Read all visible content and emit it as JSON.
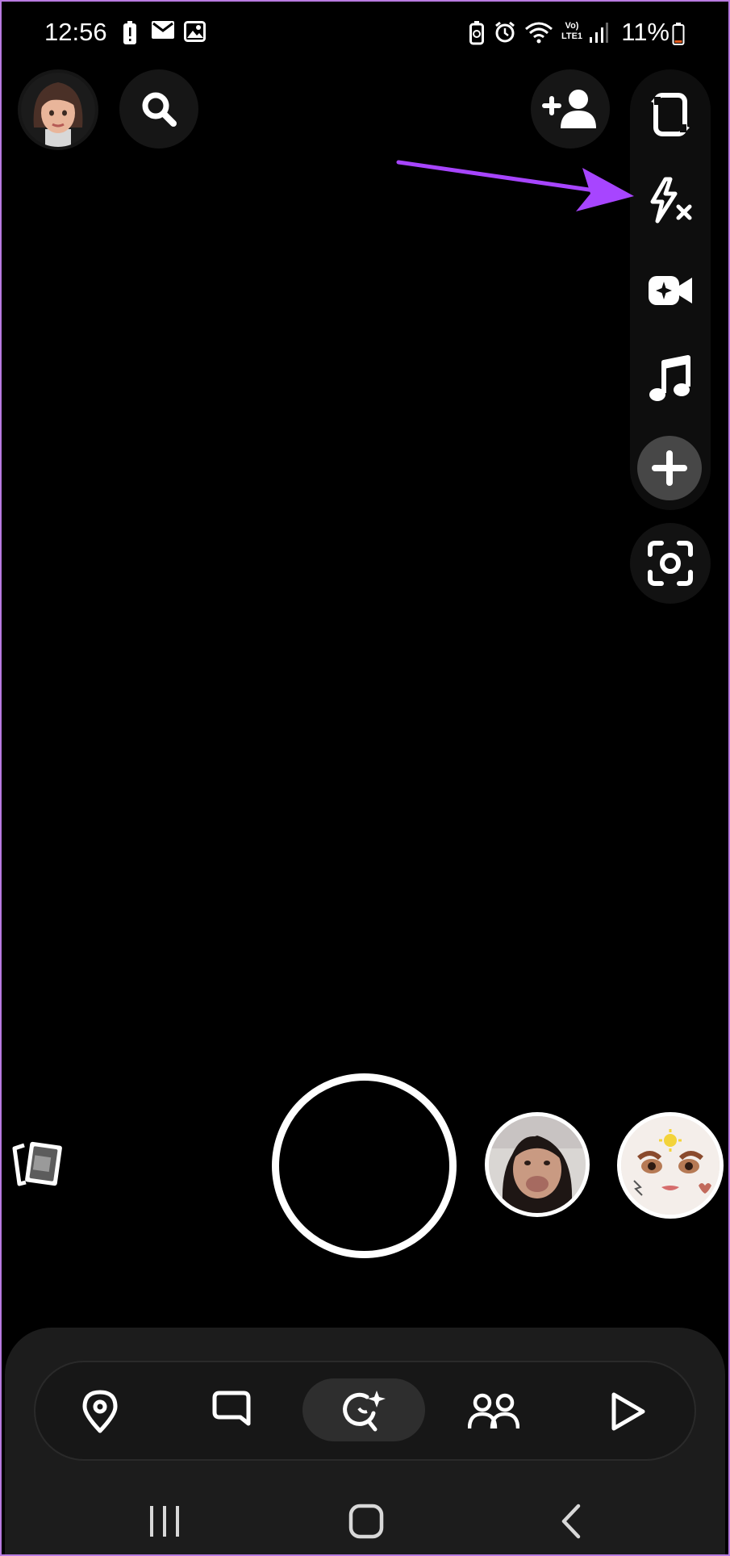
{
  "status_bar": {
    "time": "12:56",
    "battery_percent": "11%",
    "network_label": "Vo) LTE1",
    "left_icons": [
      "battery-alert-icon",
      "mail-icon",
      "image-icon"
    ],
    "right_icons": [
      "battery-saver-icon",
      "alarm-icon",
      "wifi-icon",
      "signal-icon",
      "battery-icon"
    ]
  },
  "top_bar": {
    "avatar": "profile-avatar",
    "search": "search-icon",
    "add_friend": "add-friend-icon"
  },
  "camera_tools": [
    "flip-camera-icon",
    "flash-off-icon",
    "video-chat-icon",
    "music-icon",
    "plus-icon",
    "scan-icon"
  ],
  "capture": {
    "memories": "memories-icon",
    "lenses": [
      "lens-face-puff",
      "lens-cute-face"
    ]
  },
  "bottom_nav": {
    "items": [
      "map-icon",
      "chat-icon",
      "camera-lens-icon",
      "stories-icon",
      "spotlight-icon"
    ],
    "active_index": 2
  },
  "system_nav": [
    "recents-icon",
    "home-icon",
    "back-icon"
  ],
  "colors": {
    "accent_arrow": "#a745ff",
    "frame_border": "#b97be0",
    "background": "#000000"
  }
}
